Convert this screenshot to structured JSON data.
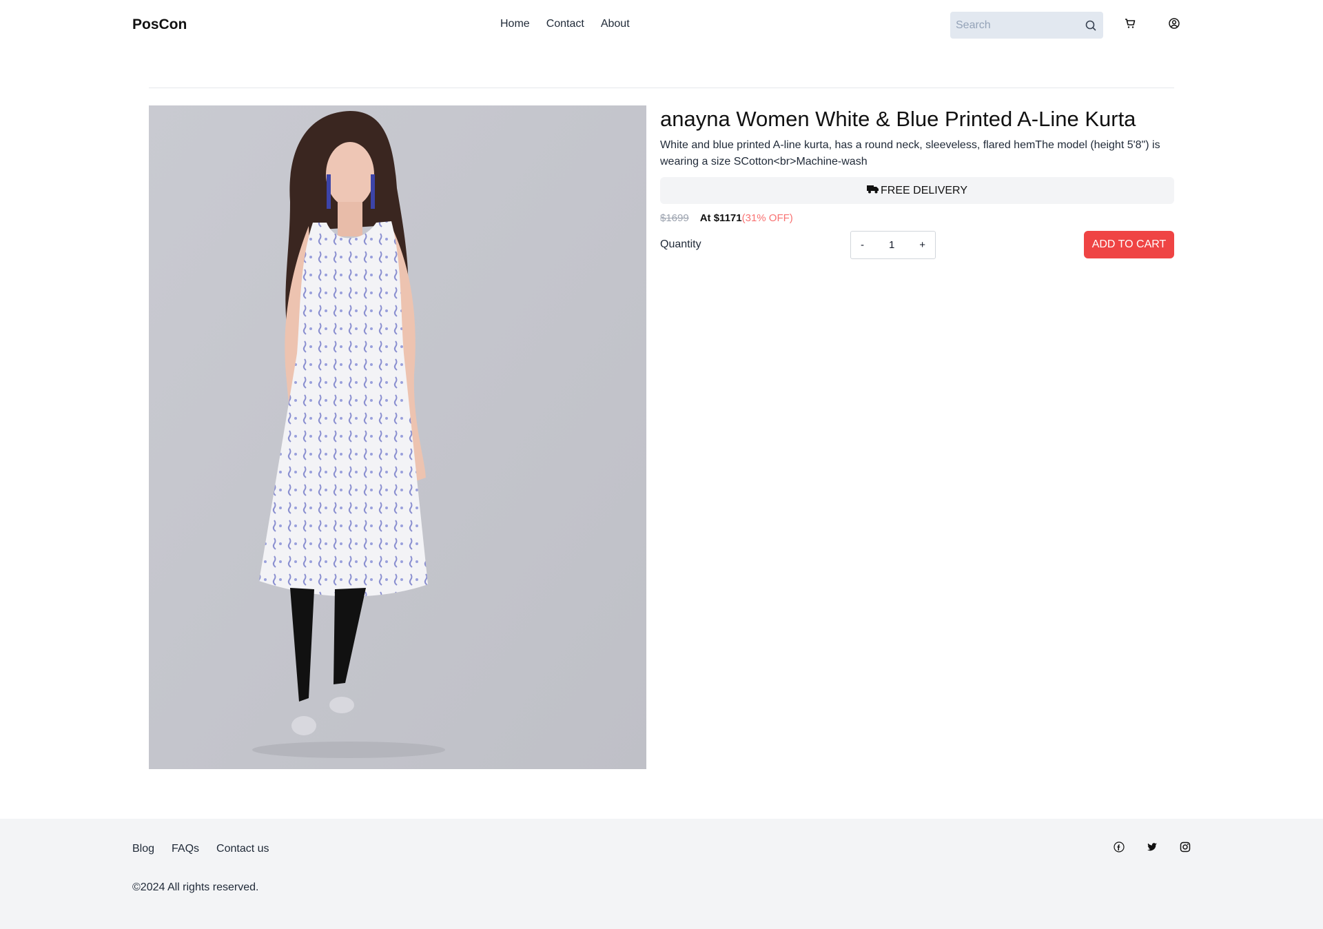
{
  "header": {
    "brand": "PosCon",
    "nav": [
      {
        "label": "Home"
      },
      {
        "label": "Contact"
      },
      {
        "label": "About"
      }
    ],
    "search": {
      "placeholder": "Search",
      "value": ""
    },
    "icons": [
      "search-icon",
      "cart-icon",
      "user-icon"
    ]
  },
  "product": {
    "image_alt": "anayna Women White & Blue Printed A-Line Kurta",
    "title": "anayna Women White & Blue Printed A-Line Kurta",
    "description": "White and blue printed A-line kurta, has a round neck, sleeveless, flared hemThe model (height 5'8\") is wearing a size SCotton<br>Machine-wash",
    "delivery_label": "FREE DELIVERY",
    "mrp": "$1699",
    "price": "At $1171",
    "discount": "(31% OFF)",
    "quantity_label": "Quantity",
    "quantity": {
      "decrement": "-",
      "value": "1",
      "increment": "+"
    },
    "add_to_cart": "ADD TO CART"
  },
  "footer": {
    "links": [
      {
        "label": "Blog"
      },
      {
        "label": "FAQs"
      },
      {
        "label": "Contact us"
      }
    ],
    "social_icons": [
      "facebook-icon",
      "twitter-icon",
      "instagram-icon"
    ],
    "copyright": "©2024 All rights reserved."
  },
  "colors": {
    "accent": "#ef4444",
    "discount": "#f87171",
    "search_bg": "#e2e8f0",
    "footer_bg": "#f3f4f6"
  }
}
